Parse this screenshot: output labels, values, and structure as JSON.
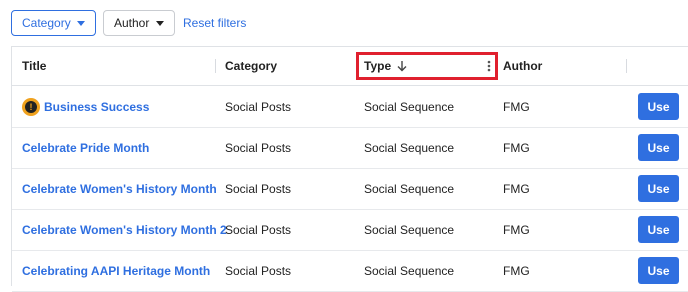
{
  "filters": {
    "category_label": "Category",
    "author_label": "Author",
    "reset_label": "Reset filters"
  },
  "table": {
    "headers": {
      "title": "Title",
      "category": "Category",
      "type": "Type",
      "author": "Author"
    },
    "rows": [
      {
        "title": "Business Success",
        "category": "Social Posts",
        "type": "Social Sequence",
        "author": "FMG",
        "action": "Use",
        "icon": "warning-icon"
      },
      {
        "title": "Celebrate Pride Month",
        "category": "Social Posts",
        "type": "Social Sequence",
        "author": "FMG",
        "action": "Use"
      },
      {
        "title": "Celebrate Women's History Month",
        "category": "Social Posts",
        "type": "Social Sequence",
        "author": "FMG",
        "action": "Use"
      },
      {
        "title": "Celebrate Women's History Month 2",
        "category": "Social Posts",
        "type": "Social Sequence",
        "author": "FMG",
        "action": "Use"
      },
      {
        "title": "Celebrating AAPI Heritage Month",
        "category": "Social Posts",
        "type": "Social Sequence",
        "author": "FMG",
        "action": "Use"
      }
    ]
  },
  "colors": {
    "accent": "#2f6fe0",
    "highlight": "#e0202e",
    "warning": "#f0a21e"
  }
}
